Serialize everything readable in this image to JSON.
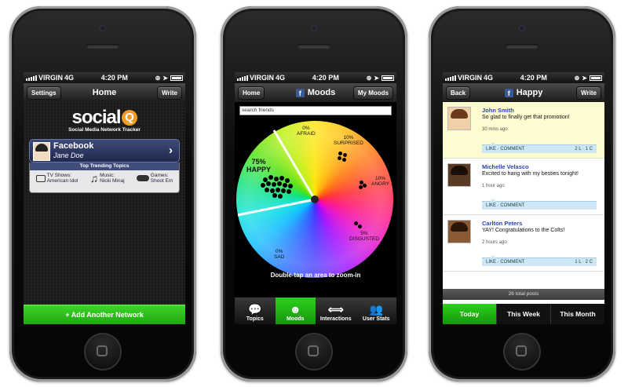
{
  "status": {
    "carrier": "VIRGIN",
    "network": "4G",
    "time": "4:20 PM"
  },
  "phone1": {
    "nav": {
      "left": "Settings",
      "title": "Home",
      "right": "Write"
    },
    "logo": {
      "word": "social",
      "q": "Q",
      "tagline": "Social Media Network Tracker"
    },
    "network_card": {
      "name": "Facebook",
      "user": "Jane Doe",
      "chevron": "›"
    },
    "trending": {
      "header": "Top Trending Topics",
      "items": [
        {
          "icon": "tv-icon",
          "line1": "TV Shows:",
          "line2": "American Idol"
        },
        {
          "icon": "music-note-icon",
          "line1": "Music:",
          "line2": "Nicki Minaj"
        },
        {
          "icon": "gamepad-icon",
          "line1": "Games:",
          "line2": "Shoot Em"
        }
      ]
    },
    "add_button": "+ Add Another Network"
  },
  "phone2": {
    "nav": {
      "left": "Home",
      "title": "Moods",
      "right": "My Moods"
    },
    "search_value": "search friends",
    "moods": [
      {
        "pct": "75%",
        "label": "HAPPY"
      },
      {
        "pct": "0%",
        "label": "AFRAID"
      },
      {
        "pct": "10%",
        "label": "SURPRISED"
      },
      {
        "pct": "10%",
        "label": "ANGRY"
      },
      {
        "pct": "5%",
        "label": "DISGUSTED"
      },
      {
        "pct": "0%",
        "label": "SAD"
      }
    ],
    "hint": "Double-tap an area to zoom-in",
    "tabs": [
      {
        "label": "Topics",
        "icon": "speech-bubble-icon",
        "active": false
      },
      {
        "label": "Moods",
        "icon": "smiley-icon",
        "active": true
      },
      {
        "label": "Interactions",
        "icon": "double-arrow-icon",
        "active": false
      },
      {
        "label": "User Stats",
        "icon": "people-icon",
        "active": false
      }
    ]
  },
  "phone3": {
    "nav": {
      "left": "Back",
      "title": "Happy",
      "right": "Write"
    },
    "posts": [
      {
        "name": "John Smith",
        "text": "So glad to finally get that promotion!",
        "ago": "30 mins ago",
        "actions": "LIKE  ·  COMMENT",
        "counts": "2 L  ·  1 C"
      },
      {
        "name": "Michelle Velasco",
        "text": "Excited to hang with my besties tonight!",
        "ago": "1 hour ago",
        "actions": "LIKE  ·  COMMENT",
        "counts": ""
      },
      {
        "name": "Carlton Peters",
        "text": "YAY! Congratulations to the Colts!",
        "ago": "2 hours ago",
        "actions": "LIKE  ·  COMMENT",
        "counts": "1 L  ·  2 C"
      }
    ],
    "total": "26 total posts",
    "segments": [
      {
        "label": "Today",
        "active": true
      },
      {
        "label": "This Week",
        "active": false
      },
      {
        "label": "This Month",
        "active": false
      }
    ]
  }
}
